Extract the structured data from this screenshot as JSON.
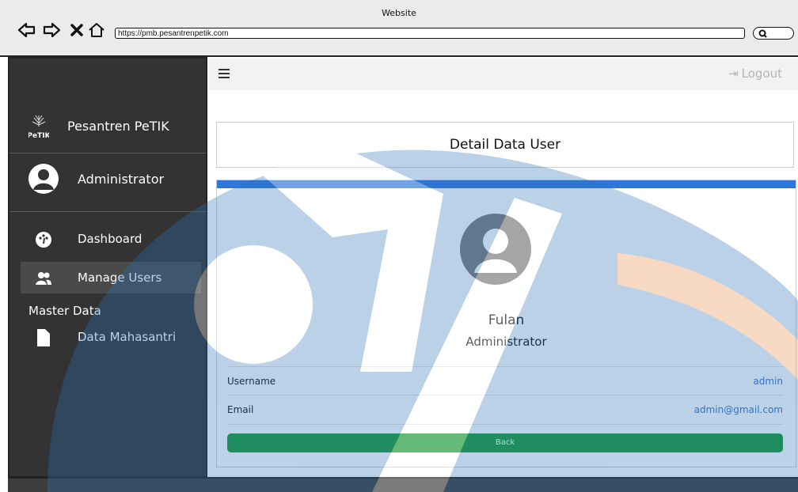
{
  "browser": {
    "title": "Website",
    "url": "https://pmb.pesantrenpetik.com"
  },
  "sidebar": {
    "brand_name": "Pesantren PeTIK",
    "logo_text": "PeTIK",
    "user_name": "Administrator",
    "items": [
      {
        "label": "Dashboard",
        "icon": "dashboard-icon"
      },
      {
        "label": "Manage Users",
        "icon": "users-icon",
        "active": true
      }
    ],
    "section_label": "Master Data",
    "section_items": [
      {
        "label": "Data Mahasantri",
        "icon": "file-icon"
      }
    ]
  },
  "topbar": {
    "logout_label": "Logout"
  },
  "page": {
    "title": "Detail Data User"
  },
  "profile": {
    "name": "Fulan",
    "role": "Administrator",
    "fields": [
      {
        "label": "Username",
        "value": "admin"
      },
      {
        "label": "Email",
        "value": "admin@gmail.com"
      }
    ],
    "back_label": "Back"
  },
  "colors": {
    "sidebar_bg": "#333333",
    "accent": "#2e77da",
    "back_button": "#1a9a36"
  }
}
